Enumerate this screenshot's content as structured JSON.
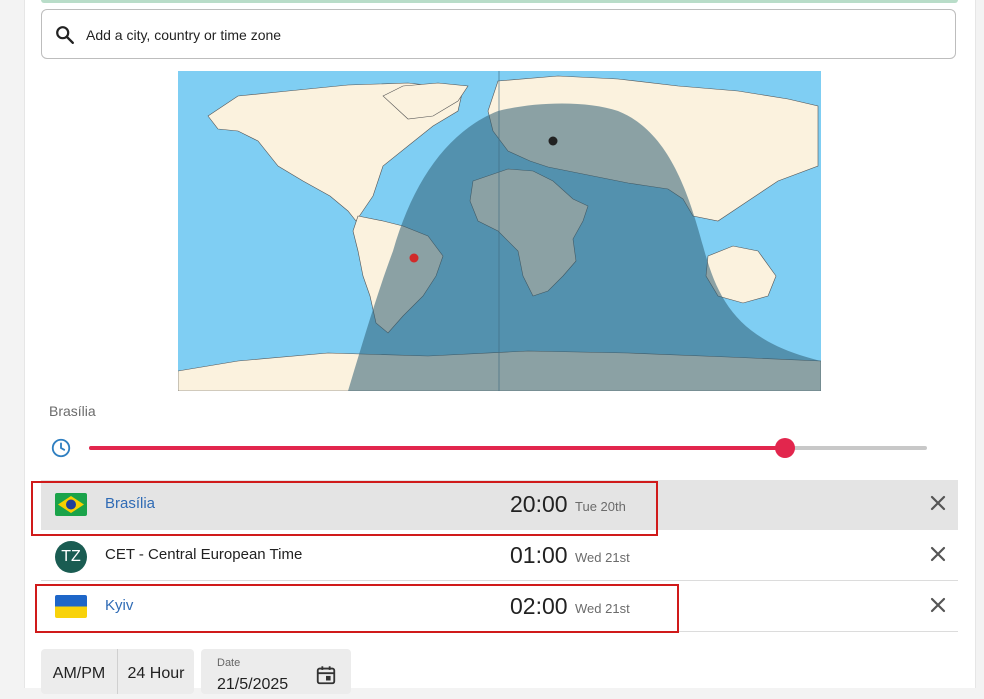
{
  "search": {
    "placeholder": "Add a city, country or time zone"
  },
  "slider": {
    "label": "Brasília",
    "value_fraction": 0.83
  },
  "rows": [
    {
      "name": "Brasília",
      "time": "20:00",
      "day": "Tue 20th",
      "flag": "brazil-flag-icon"
    },
    {
      "name": "CET - Central European Time",
      "badge": "TZ",
      "time": "01:00",
      "day": "Wed 21st"
    },
    {
      "name": "Kyiv",
      "time": "02:00",
      "day": "Wed 21st",
      "flag": "ukraine-flag-icon"
    }
  ],
  "format": {
    "ampm": "AM/PM",
    "h24": "24 Hour"
  },
  "date": {
    "label": "Date",
    "value": "21/5/2025"
  },
  "colors": {
    "accent": "#e2264d",
    "link": "#2f6bb5",
    "ocean": "#7fcef3",
    "night": "#5a96b0",
    "land": "#fbf2de",
    "land_night": "#b0a59b",
    "highlight": "#d01a1a"
  }
}
